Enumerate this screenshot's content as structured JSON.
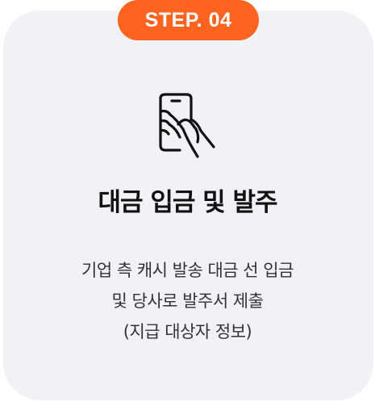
{
  "badge": {
    "label": "STEP. 04"
  },
  "icon": {
    "name": "hand-holding-phone-icon"
  },
  "title": "대금 입금 및 발주",
  "description": {
    "lines": [
      "기업 측 캐시 발송 대금 선 입금",
      "및 당사로 발주서 제출",
      "(지급 대상자 정보)"
    ]
  },
  "colors": {
    "accent": "#fe6420",
    "card_background": "#f1f2f6",
    "title_text": "#111111",
    "body_text": "#333333"
  }
}
